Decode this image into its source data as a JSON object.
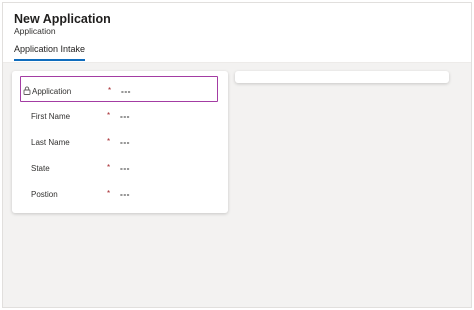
{
  "header": {
    "title": "New Application",
    "subtitle": "Application",
    "tab_label": "Application Intake"
  },
  "form": {
    "fields": [
      {
        "label": "Application",
        "required": "*",
        "value": "---",
        "locked": true
      },
      {
        "label": "First Name",
        "required": "*",
        "value": "---",
        "locked": false
      },
      {
        "label": "Last Name",
        "required": "*",
        "value": "---",
        "locked": false
      },
      {
        "label": "State",
        "required": "*",
        "value": "---",
        "locked": false
      },
      {
        "label": "Postion",
        "required": "*",
        "value": "---",
        "locked": false
      }
    ]
  },
  "colors": {
    "accent": "#0f6cbd",
    "focus_border": "#a33ca3",
    "required": "#a4262c",
    "background": "#f3f2f1"
  }
}
